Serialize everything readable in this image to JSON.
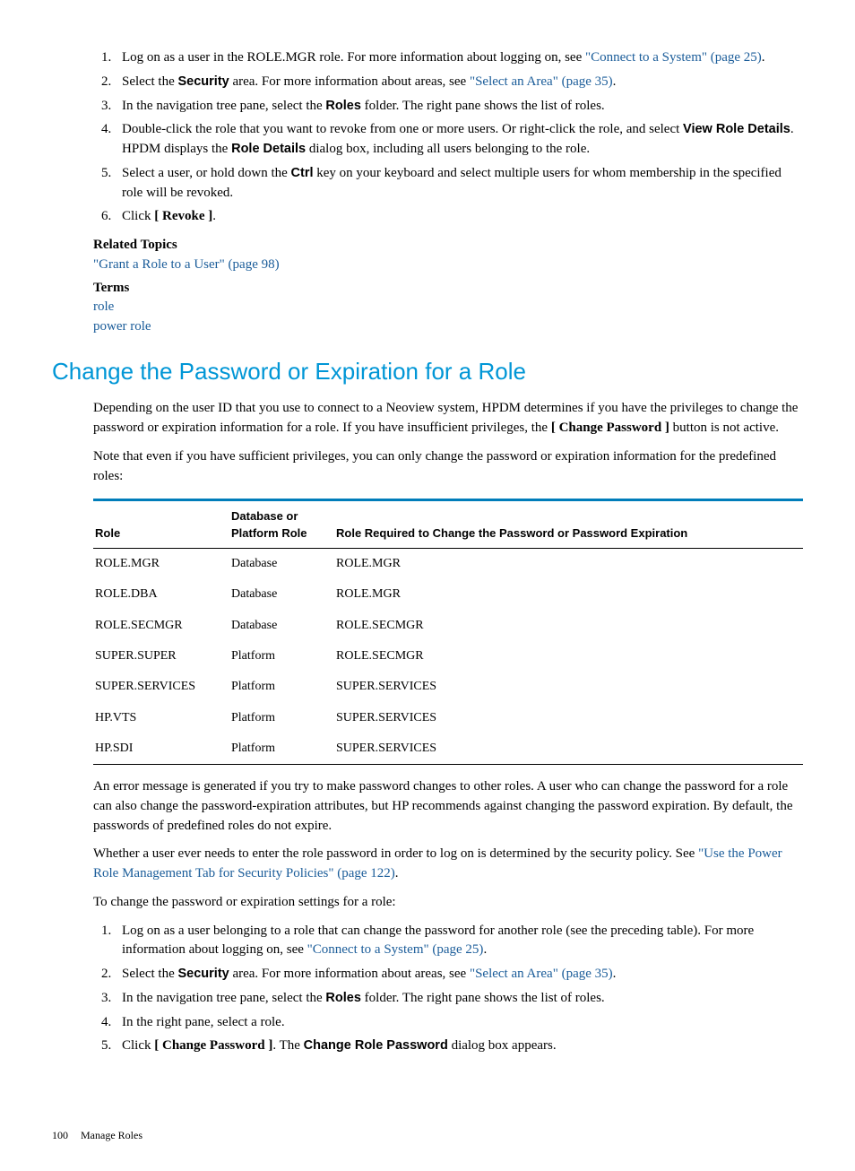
{
  "steps1": {
    "s1a": "Log on as a user in the ROLE.MGR role. For more information about logging on, see ",
    "s1b": "\"Connect to a System\" (page 25)",
    "s1c": ".",
    "s2a": "Select the ",
    "s2b": "Security",
    "s2c": " area. For more information about areas, see ",
    "s2d": "\"Select an Area\" (page 35)",
    "s2e": ".",
    "s3a": "In the navigation tree pane, select the ",
    "s3b": "Roles",
    "s3c": " folder. The right pane shows the list of roles.",
    "s4a": "Double-click the role that you want to revoke from one or more users. Or right-click the role, and select ",
    "s4b": "View Role Details",
    "s4c": ". HPDM displays the ",
    "s4d": "Role Details",
    "s4e": " dialog box, including all users belonging to the role.",
    "s5a": "Select a user, or hold down the ",
    "s5b": "Ctrl",
    "s5c": " key on your keyboard and select multiple users for whom membership in the specified role will be revoked.",
    "s6a": "Click ",
    "s6b": "[ Revoke ]",
    "s6c": "."
  },
  "related": {
    "heading": "Related Topics",
    "link1": "\"Grant a Role to a User\" (page 98)",
    "terms_heading": "Terms",
    "term1": "role",
    "term2": "power role"
  },
  "section": {
    "title": "Change the Password or Expiration for a Role",
    "p1a": "Depending on the user ID that you use to connect to a Neoview system, HPDM determines if you have the privileges to change the password or expiration information for a role. If you have insufficient privileges, the ",
    "p1b": "[ Change Password ]",
    "p1c": " button is not active.",
    "p2": "Note that even if you have sufficient privileges, you can only change the password or expiration information for the predefined roles:"
  },
  "table": {
    "headers": {
      "h1": "Role",
      "h2a": "Database or",
      "h2b": "Platform Role",
      "h3": "Role Required to Change the Password or Password Expiration"
    },
    "rows": [
      {
        "c1": "ROLE.MGR",
        "c2": "Database",
        "c3": "ROLE.MGR"
      },
      {
        "c1": "ROLE.DBA",
        "c2": "Database",
        "c3": "ROLE.MGR"
      },
      {
        "c1": "ROLE.SECMGR",
        "c2": "Database",
        "c3": "ROLE.SECMGR"
      },
      {
        "c1": "SUPER.SUPER",
        "c2": "Platform",
        "c3": "ROLE.SECMGR"
      },
      {
        "c1": "SUPER.SERVICES",
        "c2": "Platform",
        "c3": "SUPER.SERVICES"
      },
      {
        "c1": "HP.VTS",
        "c2": "Platform",
        "c3": "SUPER.SERVICES"
      },
      {
        "c1": "HP.SDI",
        "c2": "Platform",
        "c3": "SUPER.SERVICES"
      }
    ]
  },
  "after_table": {
    "p1": "An error message is generated if you try to make password changes to other roles. A user who can change the password for a role can also change the password-expiration attributes, but HP recommends against changing the password expiration. By default, the passwords of predefined roles do not expire.",
    "p2a": "Whether a user ever needs to enter the role password in order to log on is determined by the security policy. See ",
    "p2b": "\"Use the Power Role Management Tab for Security Policies\" (page 122)",
    "p2c": ".",
    "p3": "To change the password or expiration settings for a role:"
  },
  "steps2": {
    "s1a": "Log on as a user belonging to a role that can change the password for another role (see the preceding table). For more information about logging on, see ",
    "s1b": "\"Connect to a System\" (page 25)",
    "s1c": ".",
    "s2a": "Select the ",
    "s2b": "Security",
    "s2c": " area. For more information about areas, see ",
    "s2d": "\"Select an Area\" (page 35)",
    "s2e": ".",
    "s3a": "In the navigation tree pane, select the ",
    "s3b": "Roles",
    "s3c": " folder. The right pane shows the list of roles.",
    "s4": "In the right pane, select a role.",
    "s5a": "Click ",
    "s5b": "[ Change Password ]",
    "s5c": ". The ",
    "s5d": "Change Role Password",
    "s5e": " dialog box appears."
  },
  "footer": {
    "page": "100",
    "text": "Manage Roles"
  }
}
